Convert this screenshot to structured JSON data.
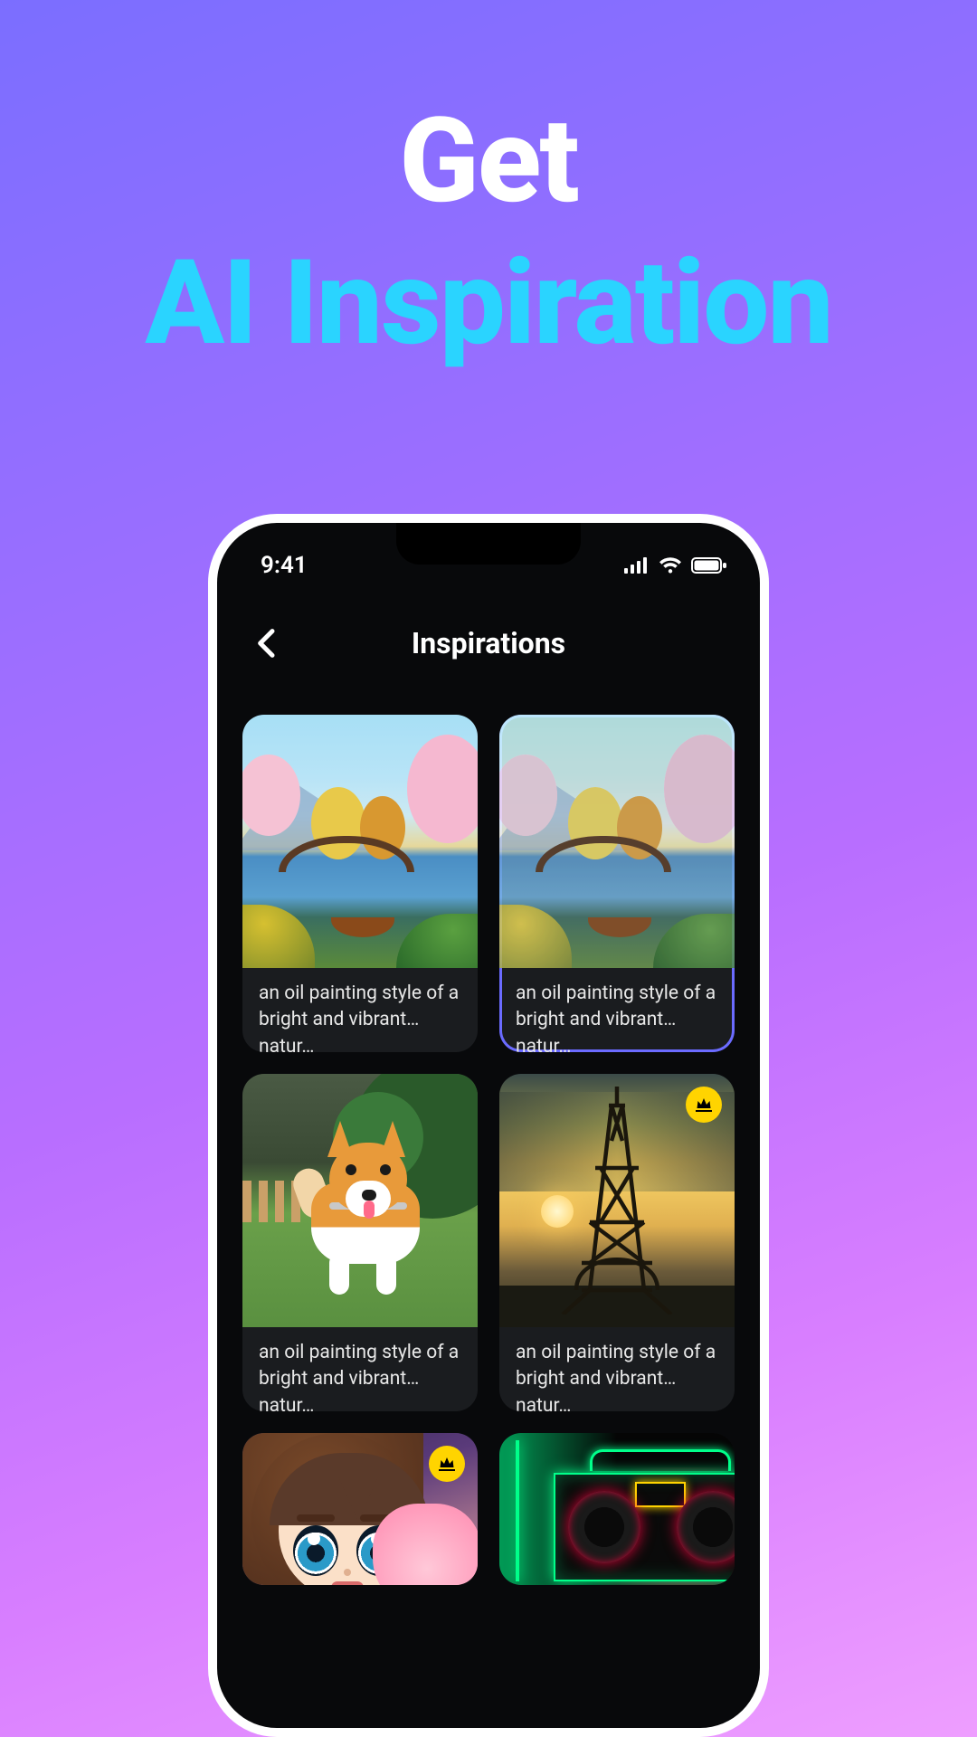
{
  "hero": {
    "line1": "Get",
    "line2": "AI Inspiration"
  },
  "status": {
    "time": "9:41"
  },
  "nav": {
    "title": "Inspirations"
  },
  "cards": [
    {
      "caption": "an oil painting style of a bright and vibrant natur…",
      "selected": false,
      "premium": false
    },
    {
      "caption": "an oil painting style of a bright and vibrant natur…",
      "selected": true,
      "premium": false
    },
    {
      "caption": "an oil painting style of a bright and vibrant natur…",
      "selected": false,
      "premium": false
    },
    {
      "caption": "an oil painting style of a bright and vibrant natur…",
      "selected": false,
      "premium": true
    },
    {
      "caption": "",
      "selected": false,
      "premium": true
    },
    {
      "caption": "",
      "selected": false,
      "premium": false
    }
  ]
}
